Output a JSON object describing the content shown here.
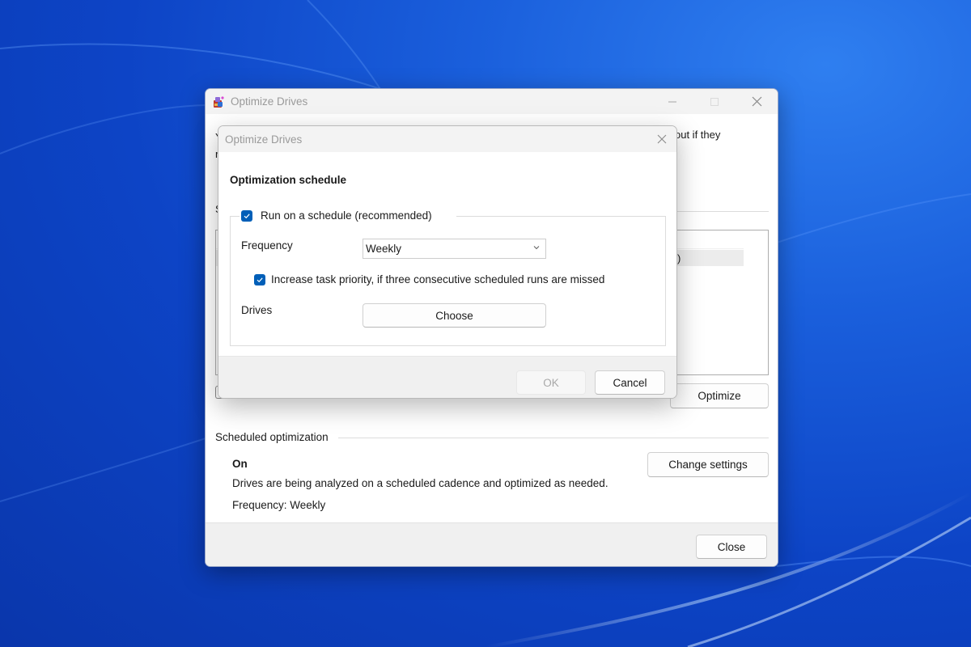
{
  "main_window": {
    "title": "Optimize Drives",
    "intro_fragment_left_1": "Y",
    "intro_fragment_left_2": "r",
    "intro_fragment_right": "out if they",
    "status_fragment": "S",
    "drive_row_fragment": ")",
    "optimize_label": "Optimize",
    "scheduled_section": {
      "label": "Scheduled optimization",
      "state": "On",
      "description": "Drives are being analyzed on a scheduled cadence and optimized as needed.",
      "frequency_text": "Frequency: Weekly",
      "change_settings_label": "Change settings"
    },
    "close_label": "Close",
    "icons": {
      "app": "defrag-app-icon",
      "minimize": "minimize-icon",
      "maximize": "maximize-icon",
      "close": "close-icon"
    }
  },
  "dialog": {
    "title": "Optimize Drives",
    "heading": "Optimization schedule",
    "run_on_schedule": {
      "label": "Run on a schedule (recommended)",
      "checked": true
    },
    "frequency": {
      "label": "Frequency",
      "value": "Weekly"
    },
    "increase_priority": {
      "label": "Increase task priority, if three consecutive scheduled runs are missed",
      "checked": true
    },
    "drives": {
      "label": "Drives",
      "button_label": "Choose"
    },
    "ok_label": "OK",
    "cancel_label": "Cancel",
    "ok_enabled": false
  },
  "colors": {
    "accent": "#005fb8",
    "titlebar": "#f3f3f3",
    "footer": "#f0f0f0",
    "wallpaper": "#0d44c6"
  }
}
